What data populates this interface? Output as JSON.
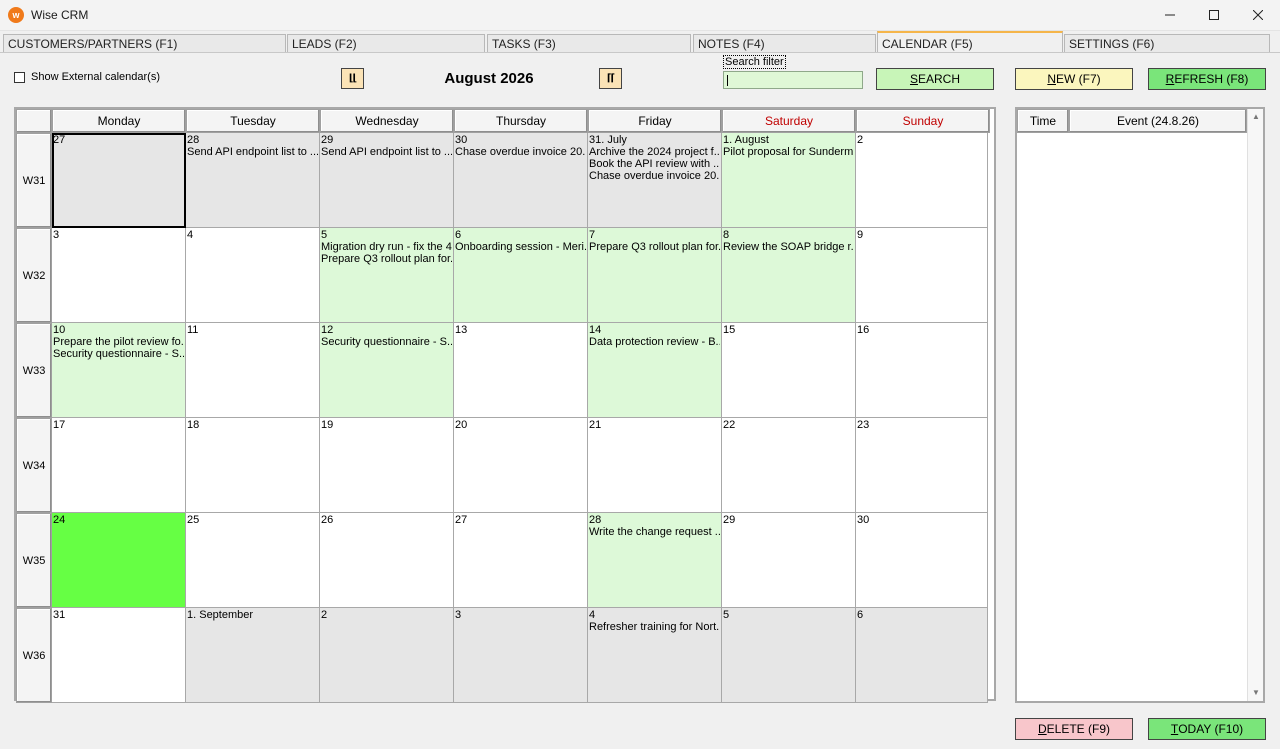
{
  "window": {
    "title": "Wise CRM"
  },
  "tabs": [
    {
      "label": "CUSTOMERS/PARTNERS (F1)"
    },
    {
      "label": "LEADS (F2)"
    },
    {
      "label": "TASKS (F3)"
    },
    {
      "label": "NOTES (F4)"
    },
    {
      "label": "CALENDAR (F5)"
    },
    {
      "label": "SETTINGS (F6)"
    }
  ],
  "controls": {
    "show_external_label": "Show External calendar(s)",
    "prev_label": "⌊⌊",
    "next_label": "⌈⌈",
    "month_title": "August 2026",
    "search_filter_label": "Search filter",
    "search_filter_value": "",
    "search_pre": "S",
    "search_rest": "EARCH",
    "new_pre": "N",
    "new_rest": "EW (F7)",
    "refresh_pre": "R",
    "refresh_rest": "EFRESH (F8)",
    "delete_pre": "D",
    "delete_rest": "ELETE (F9)",
    "today_pre": "T",
    "today_rest": "ODAY (F10)"
  },
  "calendar": {
    "days": [
      "Monday",
      "Tuesday",
      "Wednesday",
      "Thursday",
      "Friday",
      "Saturday",
      "Sunday"
    ],
    "weekend_color": "#c00000",
    "weeks": [
      {
        "label": "W31",
        "cells": [
          {
            "day": "27",
            "events": [],
            "kind": "other",
            "selected": true
          },
          {
            "day": "28",
            "events": [
              "Send API endpoint list to ..."
            ],
            "kind": "other"
          },
          {
            "day": "29",
            "events": [
              "Send API endpoint list to ..."
            ],
            "kind": "other"
          },
          {
            "day": "30",
            "events": [
              "Chase overdue invoice 20..."
            ],
            "kind": "other"
          },
          {
            "day": "31. July",
            "events": [
              "Archive the 2024 project f...",
              "Book the API review with ...",
              "Chase overdue invoice 20..."
            ],
            "kind": "other"
          },
          {
            "day": "1. August",
            "events": [
              "Pilot proposal for Sunderm..."
            ],
            "kind": "ev"
          },
          {
            "day": "2",
            "events": [],
            "kind": "normal"
          }
        ]
      },
      {
        "label": "W32",
        "cells": [
          {
            "day": "3",
            "events": [],
            "kind": "normal"
          },
          {
            "day": "4",
            "events": [],
            "kind": "normal"
          },
          {
            "day": "5",
            "events": [
              "Migration dry run - fix the 4...",
              "Prepare Q3 rollout plan for..."
            ],
            "kind": "ev"
          },
          {
            "day": "6",
            "events": [
              "Onboarding session - Meri..."
            ],
            "kind": "ev"
          },
          {
            "day": "7",
            "events": [
              "Prepare Q3 rollout plan for..."
            ],
            "kind": "ev"
          },
          {
            "day": "8",
            "events": [
              "Review the SOAP bridge r..."
            ],
            "kind": "ev"
          },
          {
            "day": "9",
            "events": [],
            "kind": "normal"
          }
        ]
      },
      {
        "label": "W33",
        "cells": [
          {
            "day": "10",
            "events": [
              "Prepare the pilot review fo...",
              "Security questionnaire - S..."
            ],
            "kind": "ev"
          },
          {
            "day": "11",
            "events": [],
            "kind": "normal"
          },
          {
            "day": "12",
            "events": [
              "Security questionnaire - S..."
            ],
            "kind": "ev"
          },
          {
            "day": "13",
            "events": [],
            "kind": "normal"
          },
          {
            "day": "14",
            "events": [
              "Data protection review - B..."
            ],
            "kind": "ev"
          },
          {
            "day": "15",
            "events": [],
            "kind": "normal"
          },
          {
            "day": "16",
            "events": [],
            "kind": "normal"
          }
        ]
      },
      {
        "label": "W34",
        "cells": [
          {
            "day": "17",
            "events": [],
            "kind": "normal"
          },
          {
            "day": "18",
            "events": [],
            "kind": "normal"
          },
          {
            "day": "19",
            "events": [],
            "kind": "normal"
          },
          {
            "day": "20",
            "events": [],
            "kind": "normal"
          },
          {
            "day": "21",
            "events": [],
            "kind": "normal"
          },
          {
            "day": "22",
            "events": [],
            "kind": "normal"
          },
          {
            "day": "23",
            "events": [],
            "kind": "normal"
          }
        ]
      },
      {
        "label": "W35",
        "cells": [
          {
            "day": "24",
            "events": [],
            "kind": "today"
          },
          {
            "day": "25",
            "events": [],
            "kind": "normal"
          },
          {
            "day": "26",
            "events": [],
            "kind": "normal"
          },
          {
            "day": "27",
            "events": [],
            "kind": "normal"
          },
          {
            "day": "28",
            "events": [
              "Write the change request ..."
            ],
            "kind": "ev"
          },
          {
            "day": "29",
            "events": [],
            "kind": "normal"
          },
          {
            "day": "30",
            "events": [],
            "kind": "normal"
          }
        ]
      },
      {
        "label": "W36",
        "cells": [
          {
            "day": "31",
            "events": [],
            "kind": "normal"
          },
          {
            "day": "1. September",
            "events": [],
            "kind": "other"
          },
          {
            "day": "2",
            "events": [],
            "kind": "other"
          },
          {
            "day": "3",
            "events": [],
            "kind": "other"
          },
          {
            "day": "4",
            "events": [
              "Refresher training for Nort..."
            ],
            "kind": "other"
          },
          {
            "day": "5",
            "events": [],
            "kind": "other"
          },
          {
            "day": "6",
            "events": [],
            "kind": "other"
          }
        ]
      }
    ]
  },
  "day_panel": {
    "time_header": "Time",
    "event_header": "Event (24.8.26)",
    "rows": []
  },
  "colors": {
    "event_cell": "#ddf9d8",
    "other_month_cell": "#e6e6e6",
    "today_cell": "#66ff44",
    "active_tab_accent": "#f5b54a"
  }
}
